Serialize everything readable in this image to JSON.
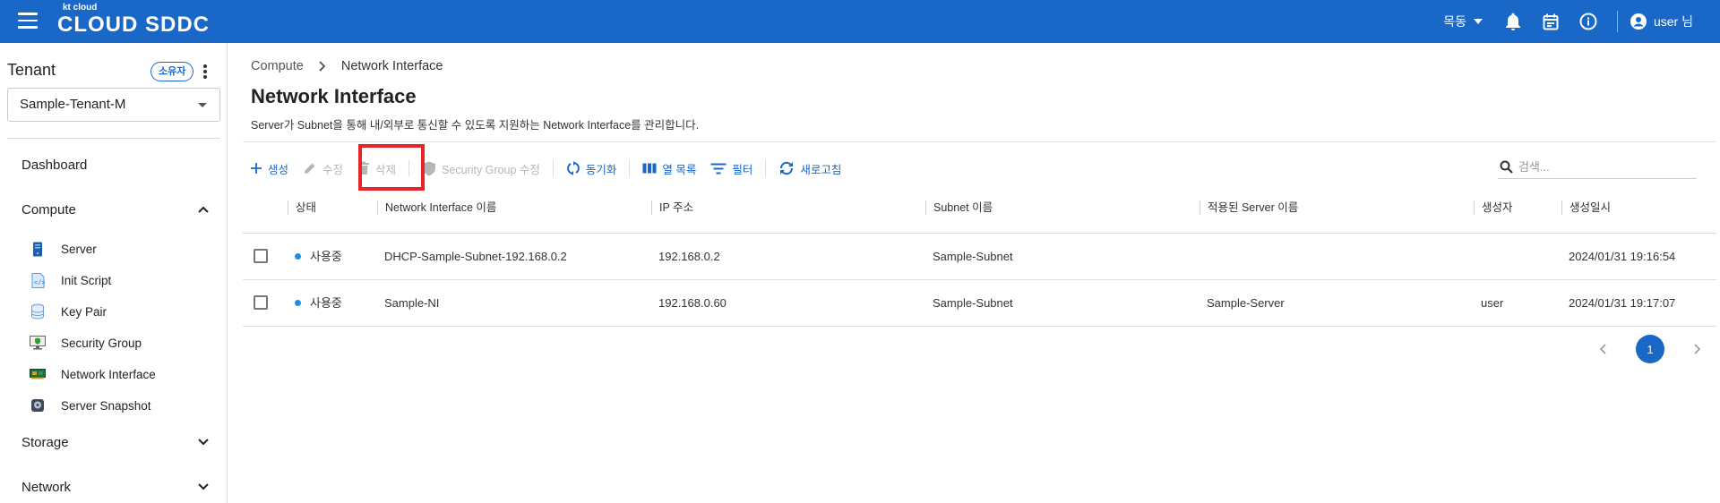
{
  "header": {
    "logo_small": "kt cloud",
    "logo_big": "CLOUD SDDC",
    "language": "목동",
    "user_label": "user 님",
    "icons": [
      "menu-icon",
      "bell-icon",
      "calendar-icon",
      "info-icon",
      "account-icon"
    ],
    "accent_color": "#1967c7"
  },
  "sidebar": {
    "tenant_title": "Tenant",
    "owner_badge": "소유자",
    "tenant_selected": "Sample-Tenant-M",
    "dashboard": "Dashboard",
    "compute": "Compute",
    "compute_items": [
      {
        "label": "Server",
        "icon": "server-icon"
      },
      {
        "label": "Init Script",
        "icon": "script-icon"
      },
      {
        "label": "Key Pair",
        "icon": "key-pair-icon"
      },
      {
        "label": "Security Group",
        "icon": "security-group-icon"
      },
      {
        "label": "Network Interface",
        "icon": "network-interface-icon"
      },
      {
        "label": "Server Snapshot",
        "icon": "snapshot-icon"
      }
    ],
    "storage": "Storage",
    "network": "Network"
  },
  "main": {
    "breadcrumb": [
      "Compute",
      "Network Interface"
    ],
    "title": "Network Interface",
    "description": "Server가 Subnet을 통해 내/외부로 통신할 수 있도록 지원하는 Network Interface를 관리합니다.",
    "toolbar": {
      "create": "생성",
      "edit": "수정",
      "delete": "삭제",
      "security_group_edit": "Security Group 수정",
      "sync": "동기화",
      "columns": "열 목록",
      "filter": "필터",
      "refresh": "새로고침"
    },
    "search": {
      "placeholder": "검색..."
    },
    "table": {
      "columns": [
        "상태",
        "Network Interface 이름",
        "IP 주소",
        "Subnet 이름",
        "적용된 Server 이름",
        "생성자",
        "생성일시"
      ],
      "rows": [
        {
          "status": "사용중",
          "name": "DHCP-Sample-Subnet-192.168.0.2",
          "ip": "192.168.0.2",
          "subnet": "Sample-Subnet",
          "server": "",
          "creator": "",
          "created": "2024/01/31 19:16:54"
        },
        {
          "status": "사용중",
          "name": "Sample-NI",
          "ip": "192.168.0.60",
          "subnet": "Sample-Subnet",
          "server": "Sample-Server",
          "creator": "user",
          "created": "2024/01/31 19:17:07"
        }
      ]
    },
    "pagination": {
      "current": "1"
    }
  }
}
